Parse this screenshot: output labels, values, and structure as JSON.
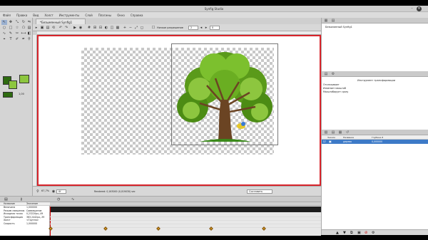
{
  "app": {
    "title": "Synfig Studio",
    "menu": [
      "Файл",
      "Правка",
      "Вид",
      "Холст",
      "Инструменты",
      "Слой",
      "Плагины",
      "Окно",
      "Справка"
    ]
  },
  "document": {
    "tab_label": "*Безымянный Synfig1",
    "toolbar": {
      "render_mode_label": "Низкое разрешение",
      "field1": "2",
      "field2": "0"
    },
    "status": {
      "zoom": "67,7%",
      "frame_field": "0f",
      "render_text": "Rendered: 0,163000 (0,019030) sec",
      "blend_label": "Составить"
    }
  },
  "colors": {
    "outline": "#2e6b10",
    "fill": "#8dc63f",
    "canvas_border": "#d8242b"
  },
  "toolbox": {
    "width_value": "1,00"
  },
  "panels": {
    "canvas_browser": {
      "item": "Безымянный Synfig1"
    },
    "tool_options": {
      "title": "Инструмент трансформации",
      "options": [
        "Отслеживает",
        "Изменяет масштаб",
        "Масштабирует сразу"
      ]
    },
    "layers": {
      "headers": [
        "Значок",
        "Название",
        "Глубина Z"
      ],
      "rows": [
        {
          "name": "дерево",
          "z": "0,000000"
        }
      ]
    }
  },
  "params": {
    "headers": [
      "Название",
      "Значение"
    ],
    "rows": [
      {
        "name": "Величина",
        "value": "1,000000"
      },
      {
        "name": "Режим смешения",
        "value": "Совмещение"
      },
      {
        "name": "Исходная точка",
        "value": "0,23220px,-49"
      },
      {
        "name": "Трансформация",
        "value": "363,2442px,-39"
      },
      {
        "name": "Холст",
        "value": "<Группа>"
      },
      {
        "name": "Скорость",
        "value": "1,000000"
      }
    ]
  }
}
